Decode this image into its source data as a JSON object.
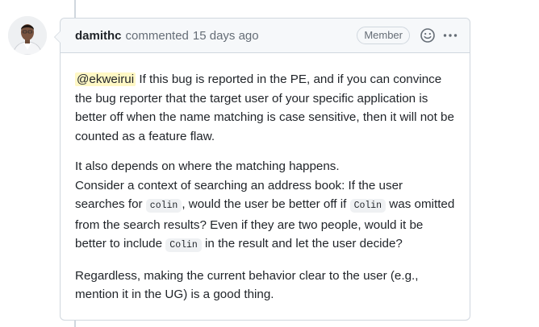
{
  "comment": {
    "author": "damithc",
    "action": "commented",
    "timestamp": "15 days ago",
    "role_badge": "Member",
    "avatar_icon": "user-avatar-photo",
    "paragraph1": {
      "mention": "@ekweirui",
      "text": " If this bug is reported in the PE, and if you can convince the bug reporter that the target user of your specific application is better off when the name matching is case sensitive, then it will not be counted as a feature flaw."
    },
    "paragraph2": {
      "line1": "It also depends on where the matching happens.",
      "seg1": "Consider a context of searching an address book: If the user searches for ",
      "code1": "colin",
      "seg2": ", would the user be better off if ",
      "code2": "Colin",
      "seg3": " was omitted from the search results? Even if they are two people, would it be better to include ",
      "code3": "Colin",
      "seg4": " in the result and let the user decide?"
    },
    "paragraph3": {
      "text": "Regardless, making the current behavior clear to the user (e.g., mention it in the UG) is a good thing."
    }
  },
  "colors": {
    "border": "#d0d7de",
    "header_bg": "#f6f8fa",
    "mention_bg": "#fff8c5",
    "muted_text": "#656d76"
  }
}
